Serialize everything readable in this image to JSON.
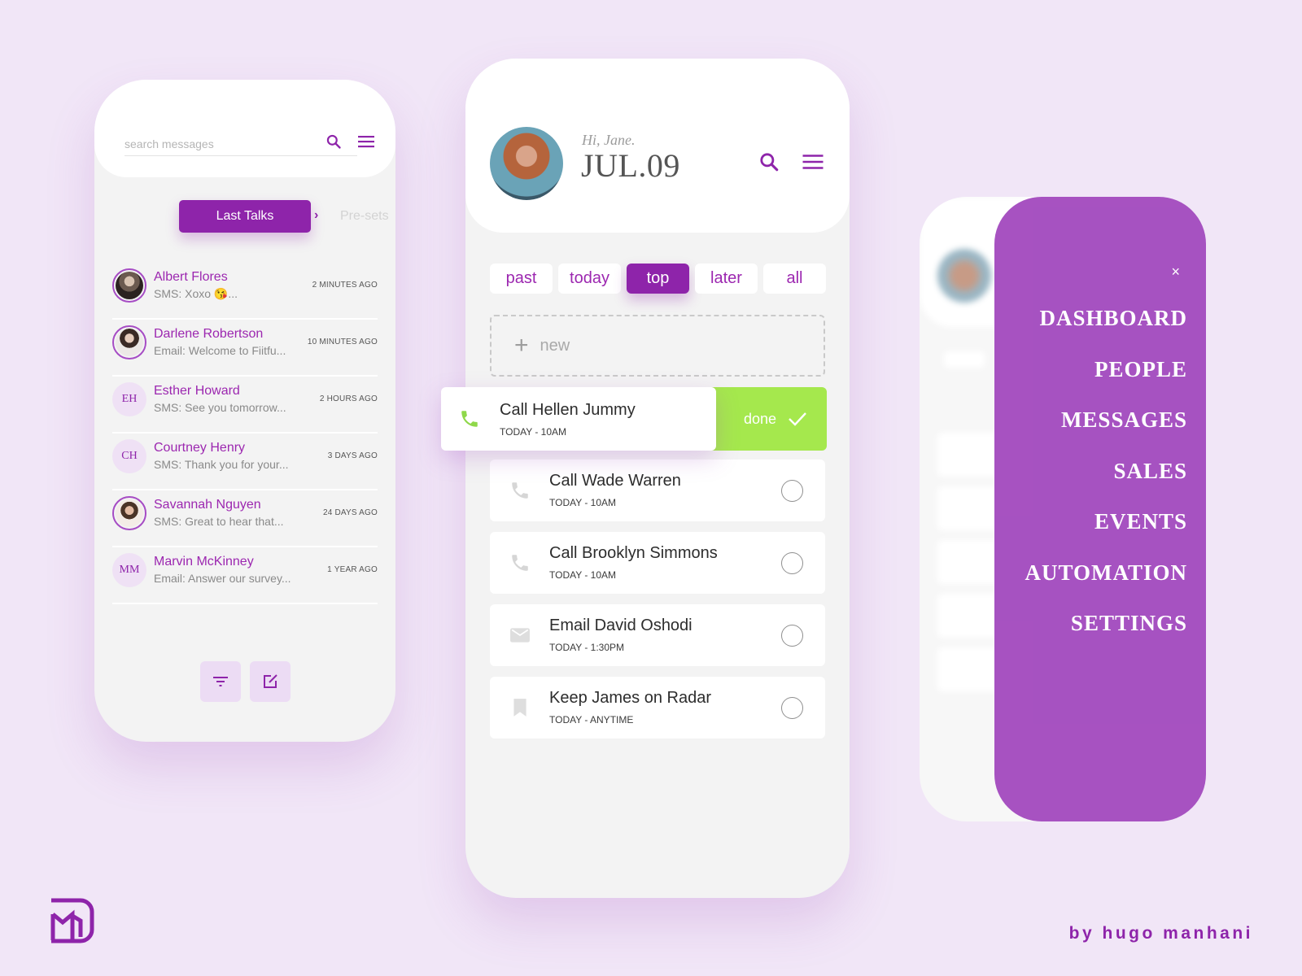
{
  "colors": {
    "background": "#f1e6f7",
    "accent": "#8e24aa",
    "menu_panel": "#a54fc0",
    "done_green": "#a5e84d",
    "initials_bg": "#efe1f5"
  },
  "messages_screen": {
    "search": {
      "placeholder": "search messages",
      "value": ""
    },
    "icons": {
      "search": "search-icon",
      "menu": "hamburger-menu-icon"
    },
    "segments": {
      "active": "Last Talks",
      "next": "Pre-sets",
      "chevron": "›"
    },
    "conversations": [
      {
        "name": "Albert Flores",
        "preview": "SMS: Xoxo 😘...",
        "time": "2 MINUTES AGO",
        "avatar": "photo",
        "initials": ""
      },
      {
        "name": "Darlene Robertson",
        "preview": "Email: Welcome to Fiitfu...",
        "time": "10 MINUTES AGO",
        "avatar": "photo",
        "initials": ""
      },
      {
        "name": "Esther Howard",
        "preview": "SMS: See you tomorrow...",
        "time": "2 HOURS AGO",
        "avatar": "initials",
        "initials": "EH"
      },
      {
        "name": "Courtney Henry",
        "preview": "SMS: Thank you for your...",
        "time": "3 DAYS AGO",
        "avatar": "initials",
        "initials": "CH"
      },
      {
        "name": "Savannah Nguyen",
        "preview": "SMS: Great to hear that...",
        "time": "24 DAYS AGO",
        "avatar": "photo",
        "initials": ""
      },
      {
        "name": "Marvin McKinney",
        "preview": "Email: Answer our survey...",
        "time": "1 YEAR AGO",
        "avatar": "initials",
        "initials": "MM"
      }
    ],
    "bottom_actions": {
      "filter": "filter-icon",
      "compose": "compose-icon"
    }
  },
  "tasks_screen": {
    "greeting": "Hi, Jane.",
    "date": "JUL.09",
    "tabs": [
      {
        "label": "past",
        "active": false
      },
      {
        "label": "today",
        "active": false
      },
      {
        "label": "top",
        "active": true
      },
      {
        "label": "later",
        "active": false
      },
      {
        "label": "all",
        "active": false
      }
    ],
    "new_task": {
      "plus": "+",
      "label": "new"
    },
    "swiped_task": {
      "title": "Call Hellen Jummy",
      "time": "TODAY - 10AM",
      "icon": "phone-icon",
      "action": "done"
    },
    "tasks": [
      {
        "title": "Call Wade Warren",
        "time": "TODAY - 10AM",
        "icon": "phone-icon"
      },
      {
        "title": "Call Brooklyn Simmons",
        "time": "TODAY - 10AM",
        "icon": "phone-icon"
      },
      {
        "title": "Email David Oshodi",
        "time": "TODAY - 1:30PM",
        "icon": "mail-icon"
      },
      {
        "title": "Keep James on Radar",
        "time": "TODAY - ANYTIME",
        "icon": "bookmark-icon"
      }
    ]
  },
  "menu_screen": {
    "close": "×",
    "items": [
      "DASHBOARD",
      "PEOPLE",
      "MESSAGES",
      "SALES",
      "EVENTS",
      "AUTOMATION",
      "SETTINGS"
    ]
  },
  "branding": {
    "credit": "by hugo manhani",
    "logo": "hm-logo"
  }
}
